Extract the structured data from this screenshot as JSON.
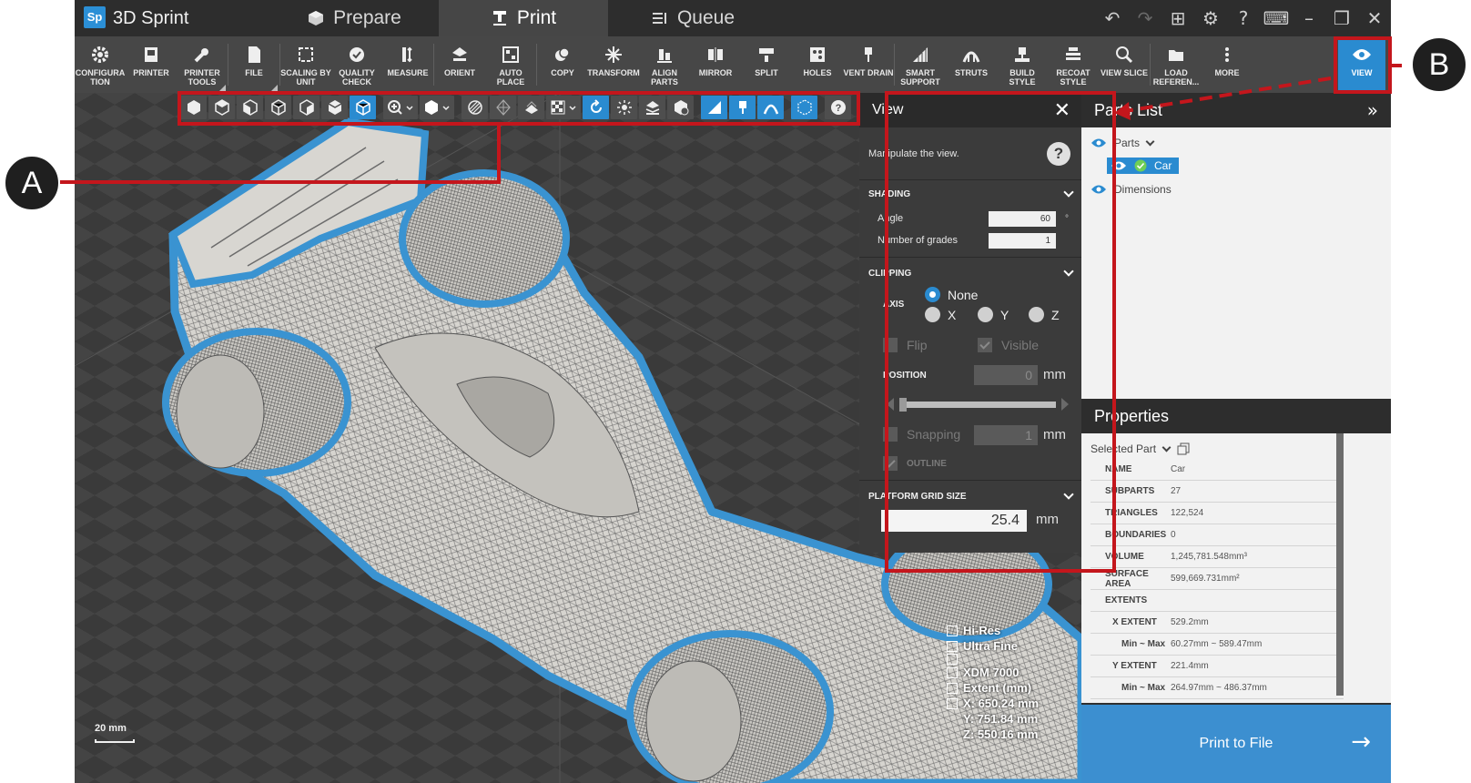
{
  "app": {
    "name": "3D Sprint",
    "logo_text": "Sp",
    "tabs": [
      {
        "label": "Prepare",
        "icon": "cube-icon"
      },
      {
        "label": "Print",
        "icon": "print-icon",
        "active": true
      },
      {
        "label": "Queue",
        "icon": "queue-list-icon"
      }
    ]
  },
  "ribbon": {
    "items": [
      {
        "label": "CONFIGURA\nTION",
        "icon": "gear-icon"
      },
      {
        "label": "PRINTER",
        "icon": "printer-icon"
      },
      {
        "label": "PRINTER\nTOOLS",
        "icon": "wrench-icon"
      },
      {
        "label": "FILE",
        "icon": "file-icon"
      },
      {
        "label": "SCALING BY\nUNIT",
        "icon": "scale-icon"
      },
      {
        "label": "QUALITY\nCHECK",
        "icon": "check-circle-icon"
      },
      {
        "label": "MEASURE",
        "icon": "measure-icon"
      },
      {
        "label": "ORIENT",
        "icon": "orient-icon"
      },
      {
        "label": "AUTO PLACE",
        "icon": "auto-place-icon"
      },
      {
        "label": "COPY",
        "icon": "copy-icon"
      },
      {
        "label": "TRANSFORM",
        "icon": "transform-icon"
      },
      {
        "label": "ALIGN\nPARTS",
        "icon": "align-icon"
      },
      {
        "label": "MIRROR",
        "icon": "mirror-icon"
      },
      {
        "label": "SPLIT",
        "icon": "split-icon"
      },
      {
        "label": "HOLES",
        "icon": "holes-icon"
      },
      {
        "label": "VENT DRAIN",
        "icon": "vent-drain-icon"
      },
      {
        "label": "SMART\nSUPPORT",
        "icon": "smart-support-icon"
      },
      {
        "label": "STRUTS",
        "icon": "struts-icon"
      },
      {
        "label": "BUILD\nSTYLE",
        "icon": "build-style-icon"
      },
      {
        "label": "RECOAT\nSTYLE",
        "icon": "recoat-style-icon"
      },
      {
        "label": "VIEW SLICE",
        "icon": "view-slice-icon"
      },
      {
        "label": "LOAD\nREFEREN...",
        "icon": "folder-icon"
      },
      {
        "label": "MORE",
        "icon": "more-vertical-icon"
      },
      {
        "label": "VIEW",
        "icon": "eye-icon",
        "active": true
      }
    ]
  },
  "view_panel": {
    "title": "View",
    "description": "Manipulate the view.",
    "shading": {
      "heading": "SHADING",
      "angle_label": "Angle",
      "angle_value": "60",
      "angle_unit": "°",
      "grades_label": "Number of grades",
      "grades_value": "1"
    },
    "clipping": {
      "heading": "CLIPPING",
      "axis_label": "AXIS",
      "options": [
        "None",
        "X",
        "Y",
        "Z"
      ],
      "selected": "None",
      "flip_label": "Flip",
      "visible_label": "Visible",
      "position_label": "POSITION",
      "position_value": "0",
      "unit": "mm",
      "snapping_label": "Snapping",
      "snapping_value": "1",
      "outline_label": "OUTLINE"
    },
    "platform_grid": {
      "heading": "PLATFORM GRID SIZE",
      "value": "25.4",
      "unit": "mm"
    }
  },
  "parts_list": {
    "title": "Parts List",
    "items": [
      {
        "label": "Parts"
      },
      {
        "label": "Car",
        "selected": true
      },
      {
        "label": "Dimensions"
      }
    ]
  },
  "properties": {
    "title": "Properties",
    "selector": "Selected Part",
    "rows": [
      {
        "key": "NAME",
        "value": "Car"
      },
      {
        "key": "SUBPARTS",
        "value": "27"
      },
      {
        "key": "TRIANGLES",
        "value": "122,524"
      },
      {
        "key": "BOUNDARIES",
        "value": "0"
      },
      {
        "key": "VOLUME",
        "value": "1,245,781.548mm³"
      },
      {
        "key": "SURFACE AREA",
        "value": "599,669.731mm²"
      },
      {
        "key": "EXTENTS",
        "value": ""
      },
      {
        "key": "X EXTENT",
        "value": "529.2mm"
      },
      {
        "key": "Min ~ Max",
        "value": "60.27mm ~ 589.47mm"
      },
      {
        "key": "Y EXTENT",
        "value": "221.4mm"
      },
      {
        "key": "Min ~ Max",
        "value": "264.97mm ~ 486.37mm"
      }
    ],
    "print_button": "Print to File"
  },
  "viewport": {
    "scale_label": "20 mm",
    "stats": [
      "Hi-Res",
      "Ultra Fine",
      "",
      "XDM 7000",
      "Extent (mm)",
      "X: 650.24 mm",
      "Y: 751.84 mm",
      "Z: 550.16 mm"
    ]
  },
  "annotations": {
    "a": "A",
    "b": "B"
  },
  "colors": {
    "accent": "#2a8bd0",
    "highlight": "#c4161c",
    "part_outline": "#3a93d1"
  }
}
